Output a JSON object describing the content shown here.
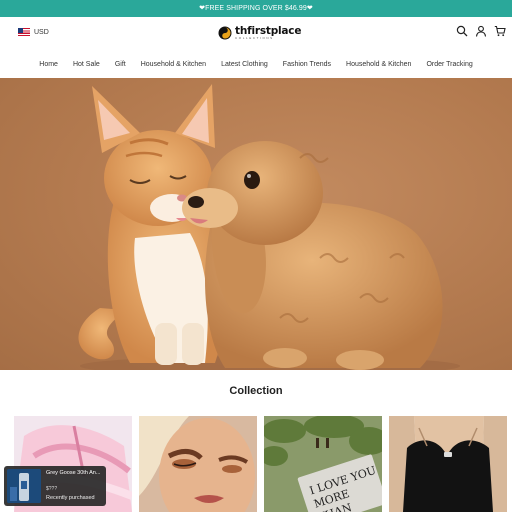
{
  "announcement": "❤FREE SHIPPING OVER $46.99❤",
  "header": {
    "currency": "USD",
    "logo": {
      "name": "thfirstplace",
      "tagline": "COLLECTIONS"
    },
    "icons": [
      "search-icon",
      "account-icon",
      "cart-icon"
    ]
  },
  "nav": {
    "items": [
      "Home",
      "Hot Sale",
      "Gift",
      "Household & Kitchen",
      "Latest Clothing",
      "Fashion Trends",
      "Household & Kitchen",
      "Order Tracking"
    ]
  },
  "collection": {
    "title": "Collection",
    "tiles": [
      "pink-wrap-product",
      "makeup-model",
      "love-you-more-sign",
      "black-bodysuit"
    ]
  },
  "popup": {
    "product": "Grey Goose 30th An...",
    "price": "$???",
    "status": "Recently purchased"
  },
  "colors": {
    "announcement_bg": "#2aa89a",
    "hero_bg": "#b37a4f"
  }
}
